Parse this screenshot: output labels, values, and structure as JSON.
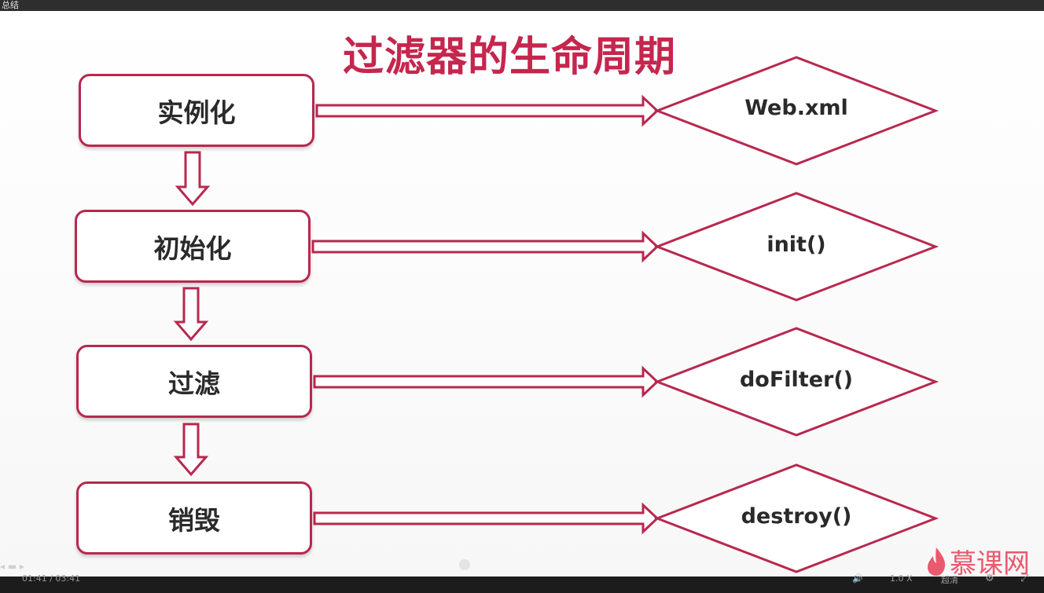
{
  "window": {
    "title": "总结"
  },
  "slide": {
    "title": "过滤器的生命周期",
    "stages": [
      {
        "label": "实例化",
        "method": "Web.xml"
      },
      {
        "label": "初始化",
        "method": "init()"
      },
      {
        "label": "过滤",
        "method": "doFilter()"
      },
      {
        "label": "销毁",
        "method": "destroy()"
      }
    ]
  },
  "branding": {
    "logo_text": "慕课网"
  },
  "player": {
    "time": "01:41 / 03:41",
    "speed": "1.0 X",
    "quality": "超清",
    "progress_fraction": 0.457
  },
  "colors": {
    "accent": "#c5264e",
    "border": "#b8284e",
    "text": "#2a2a2a"
  },
  "icons": [
    "volume-icon",
    "settings-icon",
    "fullscreen-icon",
    "flame-logo-icon"
  ]
}
